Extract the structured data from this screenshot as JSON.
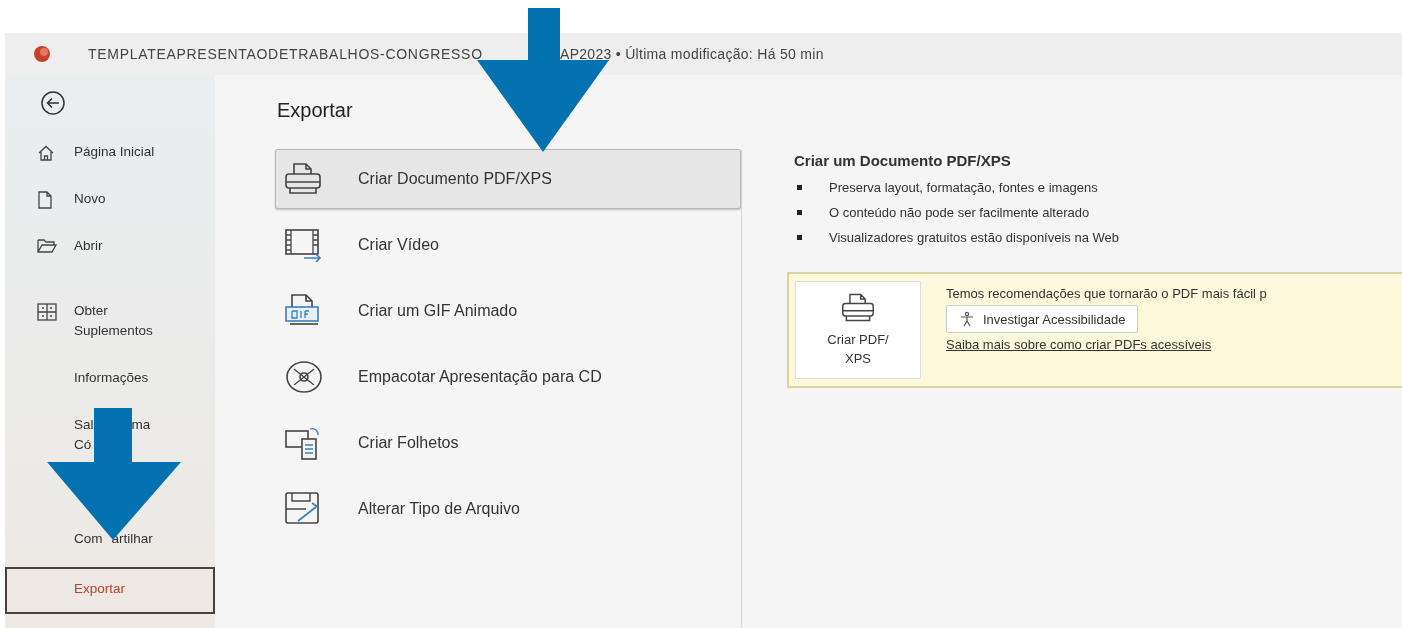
{
  "window": {
    "title_parts": [
      "TEMPLATEAPRESENTAODETRABALHOS-CONGRESSO",
      "AP2023 • Última modificação: Há 50 min"
    ]
  },
  "sidebar": {
    "items": [
      {
        "lines": [
          [
            "Página Inicial"
          ]
        ],
        "selected": false
      },
      {
        "lines": [
          [
            "Novo"
          ]
        ],
        "selected": false
      },
      {
        "lines": [
          [
            "Abrir"
          ]
        ],
        "selected": false
      },
      {
        "lines": [
          [
            "Obter"
          ],
          [
            "Suplementos"
          ]
        ],
        "selected": false
      },
      {
        "lines": [
          [
            "Informações"
          ]
        ],
        "selected": false
      },
      {
        "lines": [
          [
            "Sal",
            "ma"
          ],
          [
            "Có"
          ]
        ],
        "selected": false
      },
      {
        "lines": [
          [
            "Com",
            "artilhar"
          ]
        ],
        "selected": false
      },
      {
        "lines": [
          [
            "Exportar"
          ]
        ],
        "selected": true
      }
    ]
  },
  "main": {
    "heading": "Exportar",
    "options": [
      {
        "label": "Criar Documento PDF/XPS",
        "selected": true
      },
      {
        "label": "Criar Vídeo",
        "selected": false
      },
      {
        "label": "Criar um GIF Animado",
        "selected": false
      },
      {
        "label": "Empacotar Apresentação para CD",
        "selected": false
      },
      {
        "label": "Criar Folhetos",
        "selected": false
      },
      {
        "label": "Alterar Tipo de Arquivo",
        "selected": false
      }
    ],
    "detail": {
      "title": "Criar um Documento PDF/XPS",
      "bullets": [
        "Preserva layout, formatação, fontes e imagens",
        "O conteúdo não pode ser facilmente alterado",
        "Visualizadores gratuitos estão disponíveis na Web"
      ],
      "card": {
        "button": "Criar PDF/ XPS",
        "message": "Temos recomendações que tornarão o PDF mais fácil p",
        "check_button": "Investigar Acessibilidade",
        "link": "Saiba mais sobre como criar PDFs acessíveis"
      }
    }
  }
}
